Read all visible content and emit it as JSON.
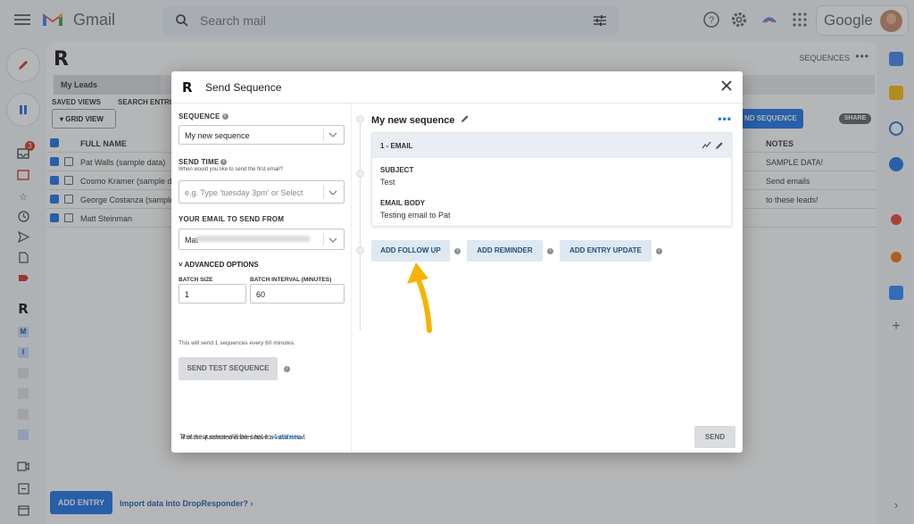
{
  "gmail": {
    "app_name": "Gmail",
    "search_placeholder": "Search mail",
    "account_label": "Google"
  },
  "sidebar": {
    "inbox_badge": "3"
  },
  "main": {
    "sequences_link": "SEQUENCES",
    "tab_label": "My Leads",
    "saved_views_label": "SAVED VIEWS",
    "search_entries_label": "SEARCH ENTRI",
    "grid_view_label": "GRID VIEW",
    "send_sequence_label": "ND SEQUENCE",
    "share_label": "SHARE",
    "columns": {
      "full_name": "FULL NAME",
      "notes": "NOTES"
    },
    "rows": [
      {
        "name": "Pat Walls (sample data)",
        "notes": "SAMPLE DATA!"
      },
      {
        "name": "Cosmo Kramer (sample da",
        "notes": "Send emails"
      },
      {
        "name": "George Costanza (sample",
        "notes": "to these leads!"
      },
      {
        "name": "Matt Steinman",
        "notes": ""
      }
    ],
    "add_entry_label": "ADD ENTRY",
    "import_link": "Import data into DropResponder? ›"
  },
  "modal": {
    "title": "Send Sequence",
    "sequence_label": "SEQUENCE",
    "sequence_value": "My new sequence",
    "send_time_label": "SEND TIME",
    "send_time_sub": "When would you like to send the first email?",
    "send_time_placeholder": "e.g. Type 'tuesday 3pm' or Select",
    "email_from_label": "YOUR EMAIL TO SEND FROM",
    "email_from_value": "Mat",
    "advanced_label": "ADVANCED OPTIONS",
    "batch_size_label": "BATCH SIZE",
    "batch_size_value": "1",
    "batch_interval_label": "BATCH INTERVAL (MINUTES)",
    "batch_interval_value": "60",
    "batch_help": "This will send 1 sequences every 60 minutes.",
    "test_button": "SEND TEST SEQUENCE",
    "valid_note": "4 of the 4 selected entries have a valid email.",
    "footer_prefix": "This sequence will be sent to ",
    "footer_link": "4 entries",
    "send_button": "SEND",
    "sequence_name": "My new sequence",
    "email_card": {
      "header": "1 - EMAIL",
      "subject_label": "SUBJECT",
      "subject_value": "Test",
      "body_label": "EMAIL BODY",
      "body_value": "Testing email to Pat"
    },
    "actions": {
      "add_follow_up": "ADD FOLLOW UP",
      "add_reminder": "ADD REMINDER",
      "add_entry_update": "ADD ENTRY UPDATE"
    }
  },
  "colors": {
    "accent": "#1a73e8",
    "arrow": "#f5b400",
    "overlay": "rgba(60,64,67,0.38)"
  }
}
